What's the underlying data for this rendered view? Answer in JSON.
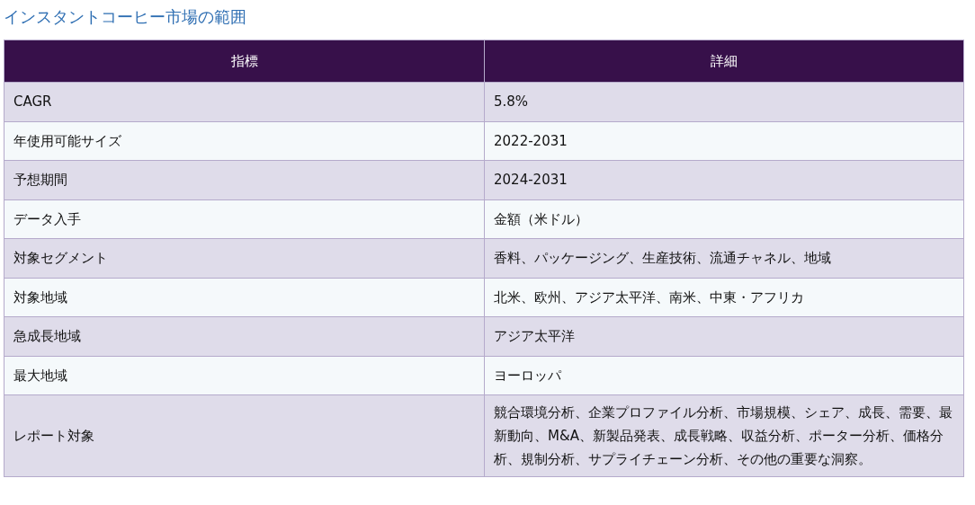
{
  "title": "インスタントコーヒー市場の範囲",
  "table": {
    "columns": [
      "指標",
      "詳細"
    ],
    "rows": [
      [
        "CAGR",
        "5.8%"
      ],
      [
        "年使用可能サイズ",
        "2022-2031"
      ],
      [
        "予想期間",
        "2024-2031"
      ],
      [
        "データ入手",
        "金額（米ドル）"
      ],
      [
        "対象セグメント",
        "香料、パッケージング、生産技術、流通チャネル、地域"
      ],
      [
        "対象地域",
        "北米、欧州、アジア太平洋、南米、中東・アフリカ"
      ],
      [
        "急成長地域",
        "アジア太平洋"
      ],
      [
        "最大地域",
        "ヨーロッパ"
      ],
      [
        "レポート対象",
        "競合環境分析、企業プロファイル分析、市場規模、シェア、成長、需要、最新動向、M&A、新製品発表、成長戦略、収益分析、ポーター分析、価格分析、規制分析、サプライチェーン分析、その他の重要な洞察。"
      ]
    ]
  }
}
